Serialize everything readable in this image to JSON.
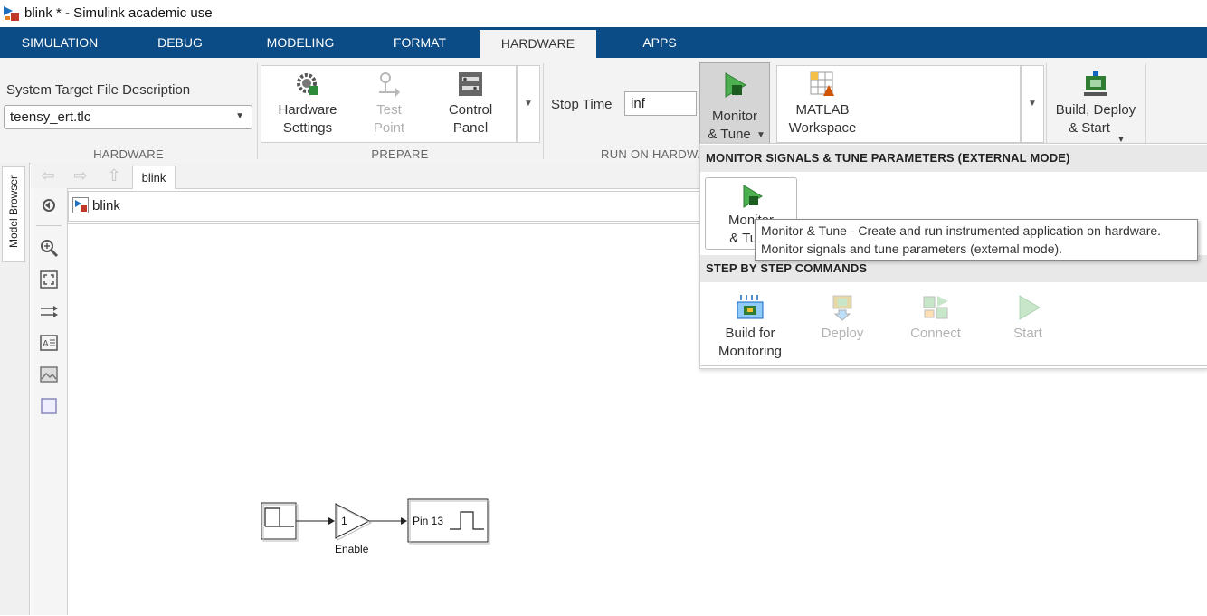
{
  "window": {
    "title": "blink * - Simulink academic use"
  },
  "tabs": [
    "SIMULATION",
    "DEBUG",
    "MODELING",
    "FORMAT",
    "HARDWARE",
    "APPS"
  ],
  "active_tab": "HARDWARE",
  "ribbon": {
    "hardware": {
      "label": "HARDWARE",
      "stf_label": "System Target File Description",
      "stf_value": "teensy_ert.tlc"
    },
    "prepare": {
      "label": "PREPARE",
      "hardware_settings": [
        "Hardware",
        "Settings"
      ],
      "test_point": [
        "Test",
        "Point"
      ],
      "control_panel": [
        "Control",
        "Panel"
      ]
    },
    "run": {
      "label": "RUN ON HARDWARE",
      "stop_time_label": "Stop Time",
      "stop_time_value": "inf",
      "monitor_tune": [
        "Monitor",
        "& Tune"
      ],
      "matlab_workspace": [
        "MATLAB",
        "Workspace"
      ]
    },
    "deploy": {
      "build_deploy": [
        "Build, Deploy",
        "& Start"
      ]
    }
  },
  "sidebar": {
    "model_browser": "Model Browser"
  },
  "editor": {
    "tab_label": "blink",
    "address": "blink"
  },
  "dropdown": {
    "header1": "MONITOR SIGNALS & TUNE PARAMETERS (EXTERNAL MODE)",
    "monitor_tune": [
      "Monitor",
      "& Tune"
    ],
    "header2": "STEP BY STEP COMMANDS",
    "build_for_monitoring": [
      "Build for",
      "Monitoring"
    ],
    "deploy": "Deploy",
    "connect": "Connect",
    "start": "Start"
  },
  "tooltip": {
    "line1": "Monitor & Tune - Create and run instrumented application on hardware.",
    "line2": "Monitor signals and tune parameters (external mode)."
  },
  "model": {
    "gain_value": "1",
    "gain_label": "Enable",
    "output_label": "Pin 13"
  }
}
